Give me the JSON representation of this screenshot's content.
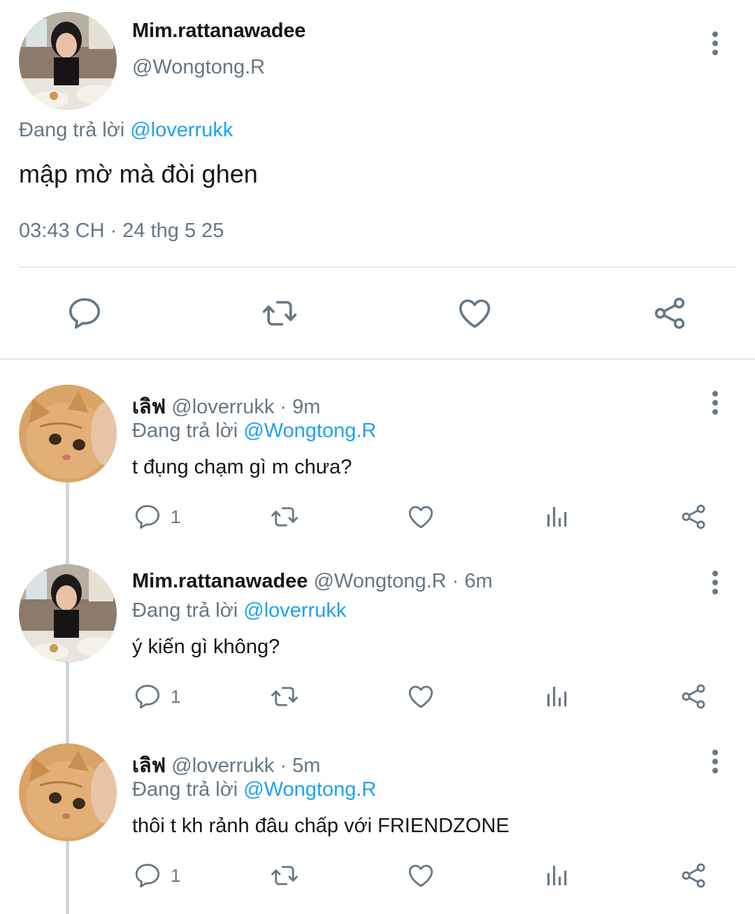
{
  "main_tweet": {
    "display_name": "Mim.rattanawadee",
    "handle": "@Wongtong.R",
    "replying_prefix": "Đang trả lời",
    "replying_to": "@loverrukk",
    "text": "mập mờ mà đòi ghen",
    "timestamp": "03:43 CH · 24 thg 5 25"
  },
  "replies": [
    {
      "display_name": "เลิฟ",
      "handle": "@loverrukk · 9m",
      "replying_prefix": "Đang trả lời",
      "replying_to": "@Wongtong.R",
      "text": "t đụng chạm gì m chưa?",
      "reply_count": "1",
      "avatar": "cat"
    },
    {
      "display_name": "Mim.rattanawadee",
      "handle": "@Wongtong.R · 6m",
      "replying_prefix": "Đang trả lời",
      "replying_to": "@loverrukk",
      "text": "ý kiến gì không?",
      "reply_count": "1",
      "avatar": "girl"
    },
    {
      "display_name": "เลิฟ",
      "handle": "@loverrukk · 5m",
      "replying_prefix": "Đang trả lời",
      "replying_to": "@Wongtong.R",
      "text": "thôi t kh rảnh đâu chấp với FRIENDZONE",
      "reply_count": "1",
      "avatar": "cat"
    }
  ],
  "colors": {
    "link": "#1da1f2",
    "secondary_text": "#657786",
    "icon": "#657786",
    "divider": "#e1e8ed"
  },
  "icons": [
    "more-vertical-icon",
    "reply-icon",
    "retweet-icon",
    "like-icon",
    "analytics-icon",
    "share-icon"
  ]
}
